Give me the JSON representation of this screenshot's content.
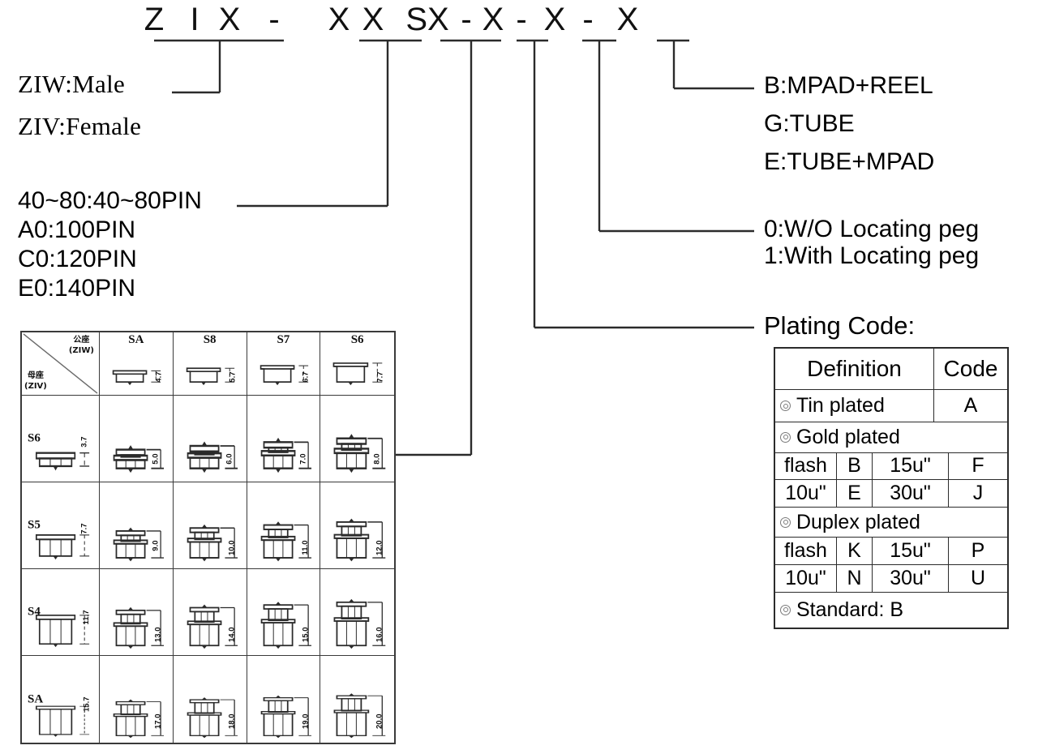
{
  "part_number": {
    "chars": [
      "Z",
      "I",
      "X",
      "-",
      "X",
      "X",
      "SX",
      "-",
      "X",
      "-",
      "X",
      "-",
      "X"
    ]
  },
  "left_labels": {
    "type_male": "ZIW:Male",
    "type_female": "ZIV:Female",
    "pin_lines": [
      "40~80:40~80PIN",
      "A0:100PIN",
      "C0:120PIN",
      "E0:140PIN"
    ]
  },
  "right_labels": {
    "packaging": [
      "B:MPAD+REEL",
      "G:TUBE",
      "E:TUBE+MPAD"
    ],
    "locating_peg": [
      "0:W/O Locating peg",
      "1:With Locating peg"
    ],
    "plating_title": "Plating Code:"
  },
  "plating_table": {
    "header": {
      "definition": "Definition",
      "code": "Code"
    },
    "tin": {
      "label": "Tin plated",
      "code": "A"
    },
    "gold": {
      "label": "Gold plated",
      "rows": [
        {
          "c1": "flash",
          "c2": "B",
          "c3": "15u\"",
          "c4": "F"
        },
        {
          "c1": "10u\"",
          "c2": "E",
          "c3": "30u\"",
          "c4": "J"
        }
      ]
    },
    "duplex": {
      "label": "Duplex plated",
      "rows": [
        {
          "c1": "flash",
          "c2": "K",
          "c3": "15u\"",
          "c4": "P"
        },
        {
          "c1": "10u\"",
          "c2": "N",
          "c3": "30u\"",
          "c4": "U"
        }
      ]
    },
    "standard": "Standard: B"
  },
  "matrix": {
    "corner": {
      "col_header_cn": "公座",
      "col_header_code": "(ZIW)",
      "row_header_cn": "母座",
      "row_header_code": "(ZIV)"
    },
    "columns": [
      {
        "name": "SA",
        "height": "4.7"
      },
      {
        "name": "S8",
        "height": "5.7"
      },
      {
        "name": "S7",
        "height": "6.7"
      },
      {
        "name": "S6",
        "height": "7.7"
      }
    ],
    "rows": [
      {
        "name": "S6",
        "height": "3.7",
        "cells": [
          "5.0",
          "6.0",
          "7.0",
          "8.0"
        ]
      },
      {
        "name": "S5",
        "height": "7.7",
        "cells": [
          "9.0",
          "10.0",
          "11.0",
          "12.0"
        ]
      },
      {
        "name": "S4",
        "height": "11.7",
        "cells": [
          "13.0",
          "14.0",
          "15.0",
          "16.0"
        ]
      },
      {
        "name": "SA",
        "height": "15.7",
        "cells": [
          "17.0",
          "18.0",
          "19.0",
          "20.0"
        ]
      }
    ]
  },
  "colors": {
    "line": "#2b2b2b",
    "text": "#111111",
    "table_border": "#3a3a3a",
    "bullet": "#7a7a7a"
  }
}
